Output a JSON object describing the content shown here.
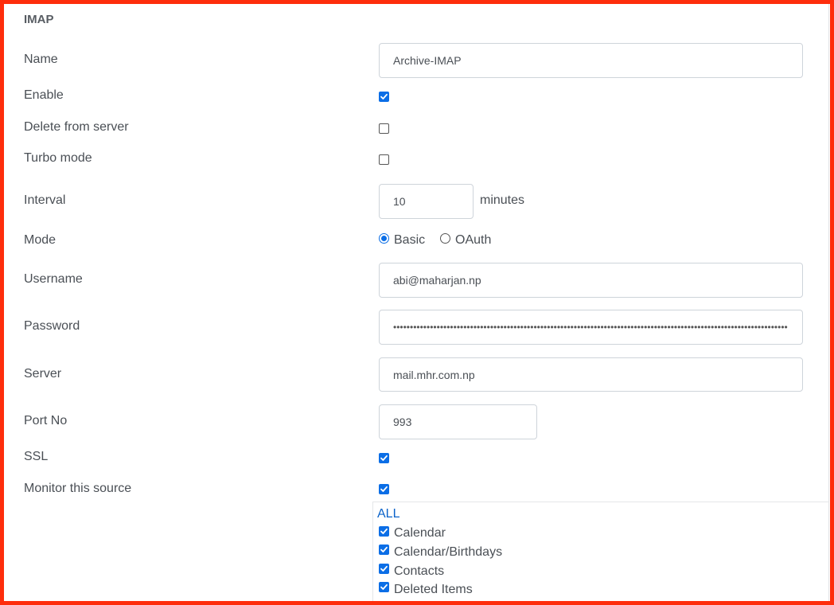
{
  "section": {
    "title": "IMAP"
  },
  "fields": {
    "name": {
      "label": "Name",
      "value": "Archive-IMAP"
    },
    "enable": {
      "label": "Enable",
      "checked": true
    },
    "delete_from_server": {
      "label": "Delete from server",
      "checked": false
    },
    "turbo_mode": {
      "label": "Turbo mode",
      "checked": false
    },
    "interval": {
      "label": "Interval",
      "value": "10",
      "unit": "minutes"
    },
    "mode": {
      "label": "Mode",
      "options": [
        "Basic",
        "OAuth"
      ],
      "selected": "Basic"
    },
    "username": {
      "label": "Username",
      "value": "abi@maharjan.np"
    },
    "password": {
      "label": "Password",
      "value": "••••••••••••••••••••••••••••••••••••••••••••••••••••••••••••••••••••••••••••••••••••••••••••••••••••••••••••••••••••••••••"
    },
    "server": {
      "label": "Server",
      "value": "mail.mhr.com.np"
    },
    "port": {
      "label": "Port No",
      "value": "993"
    },
    "ssl": {
      "label": "SSL",
      "checked": true
    },
    "monitor": {
      "label": "Monitor this source",
      "checked": true
    }
  },
  "folders": {
    "all_label": "ALL",
    "items": [
      {
        "label": "Calendar",
        "checked": true
      },
      {
        "label": "Calendar/Birthdays",
        "checked": true
      },
      {
        "label": "Contacts",
        "checked": true
      },
      {
        "label": "Deleted Items",
        "checked": true
      }
    ]
  },
  "colors": {
    "accent": "#0b6ee6",
    "frame": "#fe2d0c",
    "link": "#0b63c9"
  }
}
